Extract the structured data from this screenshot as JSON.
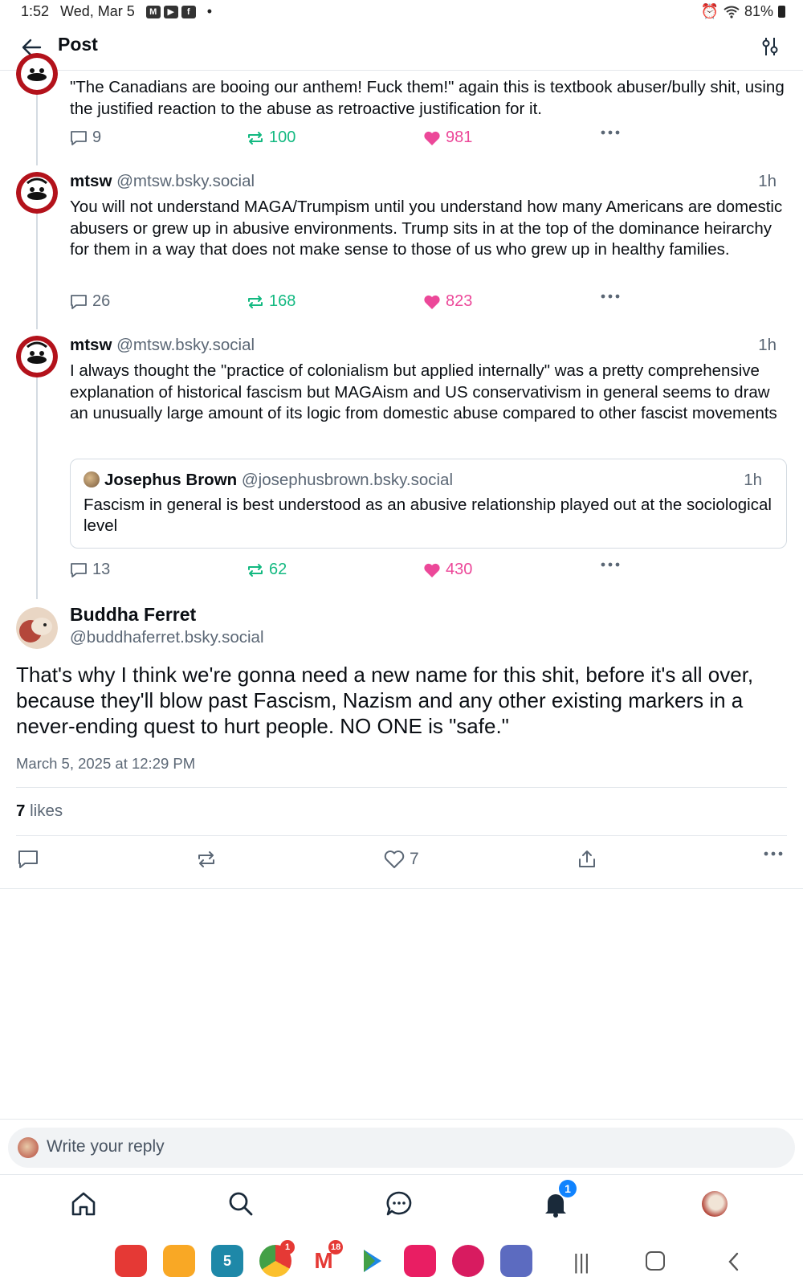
{
  "status_bar": {
    "time": "1:52",
    "date": "Wed, Mar 5",
    "battery": "81%",
    "dot": "•"
  },
  "header": {
    "title": "Post"
  },
  "thread": [
    {
      "text": "\"The Canadians are booing our anthem! Fuck them!\" again this is textbook abuser/bully shit, using the justified reaction to the abuse as retroactive justification for it.",
      "replies": "9",
      "reposts": "100",
      "likes": "981"
    },
    {
      "name": "mtsw",
      "handle": "@mtsw.bsky.social",
      "time": "1h",
      "text": "You will not understand MAGA/Trumpism until you understand how many Americans are domestic abusers or grew up in abusive environments. Trump sits in at the top of the dominance heirarchy for them in a way that does not make sense to those of us who grew up in healthy families.",
      "replies": "26",
      "reposts": "168",
      "likes": "823"
    },
    {
      "name": "mtsw",
      "handle": "@mtsw.bsky.social",
      "time": "1h",
      "text": "I always thought the \"practice of colonialism but applied internally\" was a pretty comprehensive explanation of historical fascism but MAGAism and US conservativism in general seems to draw an unusually large amount of its logic from domestic abuse compared to other fascist movements",
      "quote": {
        "name": "Josephus Brown",
        "handle": "@josephusbrown.bsky.social",
        "time": "1h",
        "text": "Fascism in general is best understood as an abusive relationship played out at the sociological level"
      },
      "replies": "13",
      "reposts": "62",
      "likes": "430"
    }
  ],
  "main_post": {
    "name": "Buddha Ferret",
    "handle": "@buddhaferret.bsky.social",
    "text": "That's why I think we're gonna need a new name for this shit, before it's all over, because they'll blow past Fascism, Nazism and any other existing markers in a never-ending quest to hurt people. NO ONE is \"safe.\"",
    "date": "March 5, 2025 at 12:29 PM",
    "likes_count": "7",
    "likes_word": "likes",
    "like_action_count": "7"
  },
  "reply_bar": {
    "placeholder": "Write your reply"
  },
  "nav": {
    "notifications_badge": "1"
  },
  "dock": {
    "calendar_day": "5",
    "chrome_badge": "1",
    "gmail_badge": "18"
  },
  "colors": {
    "repost": "#13b981",
    "like": "#ec4899",
    "muted": "#5b6775",
    "accent": "#1083fe"
  }
}
